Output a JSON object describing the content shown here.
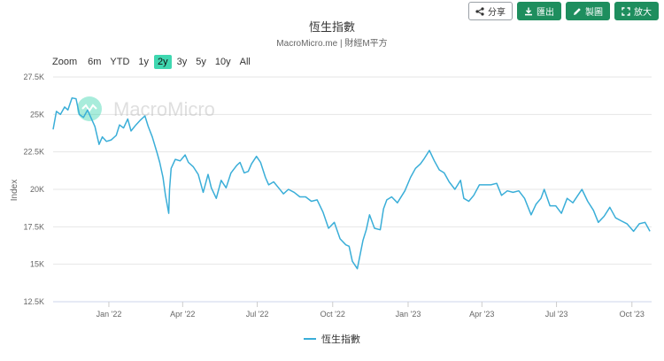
{
  "toolbar": {
    "share_label": "分享",
    "export_label": "匯出",
    "make_label": "製圖",
    "expand_label": "放大"
  },
  "header": {
    "title": "恆生指數",
    "subtitle": "MacroMicro.me | 財經M平方"
  },
  "range_selector": {
    "zoom_label": "Zoom",
    "buttons": [
      "6m",
      "YTD",
      "1y",
      "2y",
      "3y",
      "5y",
      "10y",
      "All"
    ],
    "active": "2y"
  },
  "watermark": "MacroMicro",
  "colors": {
    "line": "#3aaed8",
    "accent_button": "#1e8e5e",
    "active_range": "#3fd7b0",
    "grid": "#e6e6e6"
  },
  "chart_data": {
    "type": "line",
    "title": "恆生指數",
    "subtitle": "MacroMicro.me | 財經M平方",
    "ylabel": "Index",
    "xlabel": "",
    "xlim": [
      "2021-10-25",
      "2023-10-25"
    ],
    "ylim": [
      12500,
      27500
    ],
    "y_ticks": [
      12500,
      15000,
      17500,
      20000,
      22500,
      25000,
      27500
    ],
    "y_tick_labels": [
      "12.5K",
      "15K",
      "17.5K",
      "20K",
      "22.5K",
      "25K",
      "27.5K"
    ],
    "x_ticks": [
      "2022-01-01",
      "2022-04-01",
      "2022-07-01",
      "2022-10-01",
      "2023-01-01",
      "2023-04-01",
      "2023-07-01",
      "2023-10-01"
    ],
    "x_tick_labels": [
      "Jan '22",
      "Apr '22",
      "Jul '22",
      "Oct '22",
      "Jan '23",
      "Apr '23",
      "Jul '23",
      "Oct '23"
    ],
    "grid": true,
    "legend_position": "bottom",
    "series": [
      {
        "name": "恆生指數",
        "points": [
          [
            "2021-10-25",
            24000
          ],
          [
            "2021-10-29",
            25200
          ],
          [
            "2021-11-03",
            25000
          ],
          [
            "2021-11-08",
            25500
          ],
          [
            "2021-11-12",
            25300
          ],
          [
            "2021-11-17",
            26100
          ],
          [
            "2021-11-22",
            26050
          ],
          [
            "2021-11-26",
            25000
          ],
          [
            "2021-12-01",
            24800
          ],
          [
            "2021-12-06",
            25300
          ],
          [
            "2021-12-10",
            24800
          ],
          [
            "2021-12-15",
            24200
          ],
          [
            "2021-12-20",
            23000
          ],
          [
            "2021-12-24",
            23500
          ],
          [
            "2021-12-29",
            23200
          ],
          [
            "2022-01-04",
            23300
          ],
          [
            "2022-01-10",
            23600
          ],
          [
            "2022-01-14",
            24300
          ],
          [
            "2022-01-19",
            24100
          ],
          [
            "2022-01-24",
            24700
          ],
          [
            "2022-01-28",
            23900
          ],
          [
            "2022-02-03",
            24300
          ],
          [
            "2022-02-08",
            24600
          ],
          [
            "2022-02-14",
            24900
          ],
          [
            "2022-02-18",
            24200
          ],
          [
            "2022-02-23",
            23500
          ],
          [
            "2022-03-01",
            22400
          ],
          [
            "2022-03-04",
            21800
          ],
          [
            "2022-03-08",
            20800
          ],
          [
            "2022-03-11",
            19600
          ],
          [
            "2022-03-15",
            18400
          ],
          [
            "2022-03-16",
            20000
          ],
          [
            "2022-03-18",
            21400
          ],
          [
            "2022-03-23",
            22000
          ],
          [
            "2022-03-29",
            21900
          ],
          [
            "2022-04-04",
            22300
          ],
          [
            "2022-04-08",
            21800
          ],
          [
            "2022-04-14",
            21500
          ],
          [
            "2022-04-20",
            21000
          ],
          [
            "2022-04-26",
            19800
          ],
          [
            "2022-05-02",
            21000
          ],
          [
            "2022-05-06",
            20100
          ],
          [
            "2022-05-12",
            19400
          ],
          [
            "2022-05-18",
            20600
          ],
          [
            "2022-05-24",
            20100
          ],
          [
            "2022-05-30",
            21100
          ],
          [
            "2022-06-06",
            21600
          ],
          [
            "2022-06-10",
            21800
          ],
          [
            "2022-06-15",
            21100
          ],
          [
            "2022-06-20",
            21200
          ],
          [
            "2022-06-24",
            21700
          ],
          [
            "2022-06-30",
            22200
          ],
          [
            "2022-07-05",
            21800
          ],
          [
            "2022-07-11",
            20800
          ],
          [
            "2022-07-15",
            20300
          ],
          [
            "2022-07-21",
            20500
          ],
          [
            "2022-07-27",
            20100
          ],
          [
            "2022-08-02",
            19700
          ],
          [
            "2022-08-08",
            20000
          ],
          [
            "2022-08-15",
            19800
          ],
          [
            "2022-08-22",
            19500
          ],
          [
            "2022-08-29",
            19500
          ],
          [
            "2022-09-05",
            19200
          ],
          [
            "2022-09-12",
            19300
          ],
          [
            "2022-09-19",
            18500
          ],
          [
            "2022-09-26",
            17400
          ],
          [
            "2022-10-03",
            17800
          ],
          [
            "2022-10-10",
            16700
          ],
          [
            "2022-10-17",
            16300
          ],
          [
            "2022-10-21",
            16200
          ],
          [
            "2022-10-25",
            15200
          ],
          [
            "2022-10-31",
            14700
          ],
          [
            "2022-11-03",
            15500
          ],
          [
            "2022-11-07",
            16600
          ],
          [
            "2022-11-11",
            17300
          ],
          [
            "2022-11-15",
            18300
          ],
          [
            "2022-11-21",
            17400
          ],
          [
            "2022-11-28",
            17300
          ],
          [
            "2022-12-02",
            18700
          ],
          [
            "2022-12-06",
            19300
          ],
          [
            "2022-12-12",
            19500
          ],
          [
            "2022-12-19",
            19100
          ],
          [
            "2022-12-28",
            19900
          ],
          [
            "2023-01-04",
            20800
          ],
          [
            "2023-01-10",
            21400
          ],
          [
            "2023-01-16",
            21700
          ],
          [
            "2023-01-20",
            22000
          ],
          [
            "2023-01-27",
            22600
          ],
          [
            "2023-02-02",
            21900
          ],
          [
            "2023-02-08",
            21300
          ],
          [
            "2023-02-14",
            21100
          ],
          [
            "2023-02-20",
            20500
          ],
          [
            "2023-02-27",
            20000
          ],
          [
            "2023-03-06",
            20600
          ],
          [
            "2023-03-10",
            19400
          ],
          [
            "2023-03-16",
            19200
          ],
          [
            "2023-03-22",
            19600
          ],
          [
            "2023-03-29",
            20300
          ],
          [
            "2023-04-05",
            20300
          ],
          [
            "2023-04-12",
            20300
          ],
          [
            "2023-04-19",
            20400
          ],
          [
            "2023-04-25",
            19600
          ],
          [
            "2023-05-02",
            19900
          ],
          [
            "2023-05-09",
            19800
          ],
          [
            "2023-05-16",
            19900
          ],
          [
            "2023-05-23",
            19400
          ],
          [
            "2023-05-31",
            18300
          ],
          [
            "2023-06-06",
            19000
          ],
          [
            "2023-06-12",
            19400
          ],
          [
            "2023-06-16",
            20000
          ],
          [
            "2023-06-23",
            18900
          ],
          [
            "2023-06-30",
            18900
          ],
          [
            "2023-07-07",
            18400
          ],
          [
            "2023-07-14",
            19400
          ],
          [
            "2023-07-21",
            19100
          ],
          [
            "2023-07-27",
            19600
          ],
          [
            "2023-08-01",
            20000
          ],
          [
            "2023-08-08",
            19200
          ],
          [
            "2023-08-15",
            18600
          ],
          [
            "2023-08-21",
            17800
          ],
          [
            "2023-08-28",
            18200
          ],
          [
            "2023-09-04",
            18800
          ],
          [
            "2023-09-11",
            18100
          ],
          [
            "2023-09-18",
            17900
          ],
          [
            "2023-09-25",
            17700
          ],
          [
            "2023-10-03",
            17200
          ],
          [
            "2023-10-10",
            17700
          ],
          [
            "2023-10-17",
            17800
          ],
          [
            "2023-10-23",
            17200
          ]
        ]
      }
    ]
  }
}
